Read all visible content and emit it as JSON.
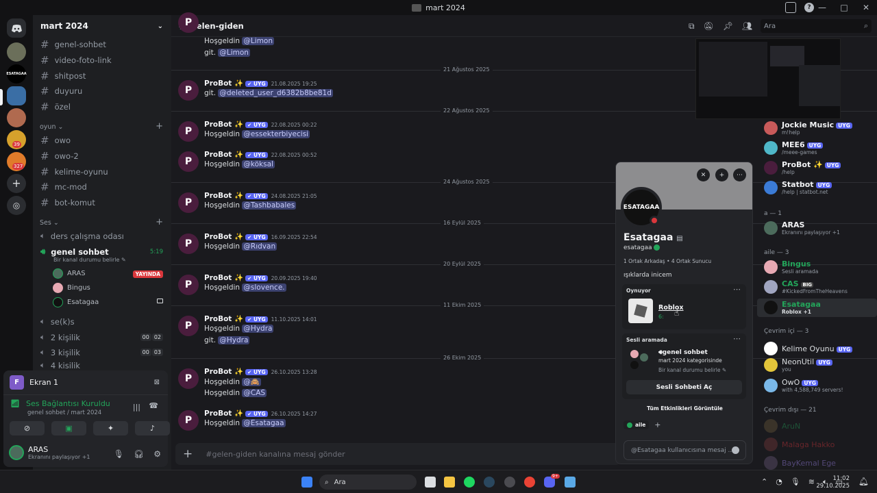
{
  "window": {
    "title": "mart 2024",
    "controls": [
      "—",
      "□",
      "✕"
    ],
    "help": "?"
  },
  "servers": {
    "badges": [
      "39",
      "327"
    ]
  },
  "sidebar": {
    "server_name": "mart 2024",
    "top_channels": [
      "genel-sohbet",
      "video-foto-link",
      "shitpost",
      "duyuru",
      "özel"
    ],
    "cat_oyun": "oyun",
    "oyun_channels": [
      "owo",
      "owo-2",
      "kelime-oyunu",
      "mc-mod",
      "bot-komut"
    ],
    "cat_ses": "Ses",
    "voice_channels": [
      "ders çalışma odası",
      "genel sohbet"
    ],
    "genel_time": "5:19",
    "genel_status": "Bir kanal durumu belirle",
    "voice_users": [
      "ARAS",
      "Bingus",
      "Esatagaa"
    ],
    "live_badge": "YAYINDA",
    "after_voice": [
      "se(k)s",
      "2 kişilik",
      "3 kişilik",
      "4 kişilik"
    ],
    "c2": [
      "00",
      "02"
    ],
    "c3": [
      "00",
      "03"
    ],
    "c4": [
      "00",
      "04"
    ]
  },
  "userpanel": {
    "screen_label": "Ekran 1",
    "screen_badge": "F",
    "connected": "Ses Bağlantısı Kuruldu",
    "connected_sub": "genel sohbet / mart 2024",
    "me_name": "ARAS",
    "me_status": "Ekranını paylaşıyor +1"
  },
  "header": {
    "channel": "gelen-giden",
    "search_placeholder": "Ara"
  },
  "messages": {
    "top_lines": [
      "Hoşgeldin @Limon",
      "git. @Limon"
    ],
    "bot": "ProBot ✨",
    "uyg": "UYG",
    "dates": [
      "21 Ağustos 2025",
      "22 Ağustos 2025",
      "24 Ağustos 2025",
      "16 Eylül 2025",
      "20 Eylül 2025",
      "11 Ekim 2025",
      "26 Ekim 2025"
    ],
    "items": [
      {
        "ts": "21.08.2025 19:25",
        "pre": "git. ",
        "mention": "@deleted_user_d6382b8be81d"
      },
      {
        "ts": "22.08.2025 00:22",
        "pre": "Hoşgeldin ",
        "mention": "@essekterbiyecisi"
      },
      {
        "ts": "22.08.2025 00:52",
        "pre": "Hoşgeldin ",
        "mention": "@köksal"
      },
      {
        "ts": "24.08.2025 21:05",
        "pre": "Hoşgeldin ",
        "mention": "@Tashbabales"
      },
      {
        "ts": "16.09.2025 22:54",
        "pre": "Hoşgeldin ",
        "mention": "@Rıdvan"
      },
      {
        "ts": "20.09.2025 19:40",
        "pre": "Hoşgeldin ",
        "mention": "@slovence."
      },
      {
        "ts": "11.10.2025 14:01",
        "pre": "Hoşgeldin ",
        "mention": "@Hydra",
        "pre2": "git. ",
        "mention2": "@Hydra"
      },
      {
        "ts": "26.10.2025 13:28",
        "pre": "Hoşgeldin ",
        "mention": "@🙈",
        "pre2": "Hoşgeldin ",
        "mention2": "@CAS"
      },
      {
        "ts": "26.10.2025 14:27",
        "pre": "Hoşgeldin ",
        "mention": "@Esatagaa"
      }
    ],
    "composer_placeholder": "#gelen-giden kanalına mesaj gönder"
  },
  "members": {
    "bots": [
      {
        "name": "Jockie Music",
        "status": "m!help"
      },
      {
        "name": "MEE6",
        "status": "/meee-games"
      },
      {
        "name": "ProBot ✨",
        "status": "/help"
      },
      {
        "name": "Statbot",
        "status": "/help | statbot.net"
      }
    ],
    "grp_a": "a — 1",
    "aras": {
      "name": "ARAS",
      "status": "Ekranını paylaşıyor +1"
    },
    "grp_aile": "aile — 3",
    "aile": [
      {
        "name": "Bingus",
        "status": "Sesli aramada"
      },
      {
        "name": "CAS",
        "tag": "BIG",
        "status": "#KickedFromTheHeavens"
      },
      {
        "name": "Esatagaa",
        "status": "Roblox +1"
      }
    ],
    "grp_online": "Çevrim içi — 3",
    "online": [
      {
        "name": "Kelime Oyunu",
        "status": ""
      },
      {
        "name": "NeonUtil",
        "status": "you"
      },
      {
        "name": "OwO",
        "status": "with 4,588,749 servers!"
      }
    ],
    "grp_offline": "Çevrim dışı — 21",
    "offline": [
      "AruN",
      "Malaga Hakko",
      "BayKemal Ege"
    ]
  },
  "popup": {
    "avatar_text": "ESATAGAA",
    "name": "Esatagaa",
    "username": "esatagaa",
    "mutuals": "1 Ortak Arkadaş  •  4 Ortak Sunucu",
    "bio": "ışıklarda inicem",
    "playing_hdr": "Oynuyor",
    "game": "Roblox",
    "game_time": "6:",
    "voice_hdr": "Sesli aramada",
    "voice_ch": "genel sohbet",
    "voice_cat": "mart 2024 kategorisinde",
    "voice_status": "Bir kanal durumu belirle",
    "voice_btn": "Sesli Sohbeti Aç",
    "all_events": "Tüm Etkinlikleri Görüntüle",
    "role": "aile",
    "msg_placeholder": "@Esatagaa kullanıcısına mesaj ..."
  },
  "taskbar": {
    "search": "Ara",
    "time": "11:02",
    "date": "29.10.2025",
    "discord_badge": "9+"
  }
}
